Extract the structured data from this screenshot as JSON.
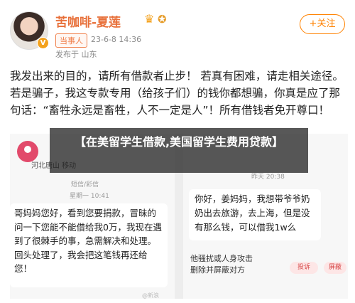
{
  "post": {
    "username": "苦咖啡-夏莲",
    "badge_icons": [
      "crown-icon",
      "fish-icon"
    ],
    "verified_icon": "v-badge-icon",
    "tag": "当事人",
    "time": "23-6-8 14:36",
    "location": "发布于 山东",
    "follow_label": "+关注",
    "text": "我发出来的目的，请所有借款者止步！ 若真有困难，请走相关途径。 若是骗子，我这专款专用（给孩子们）的钱你都想骗，你真是应了那句话：“畜牲永远是畜牲，人不一定是人”！所有借钱者免开尊口！"
  },
  "screenshot_left": {
    "contact_location": "河北唐山 移动",
    "sms_label": "短信/彩信",
    "sms_date": "星期一 10:41",
    "message": "哥妈妈您好，看到您要捐款，冒昧的问一下您能不能借给我0万，我现在遇到了很棘手的事，急需解决和处理。回头处理了，我会把这笔钱再还给您！",
    "watermark": "@新浪"
  },
  "screenshot_right": {
    "date": "昨天 20:38",
    "message": "你好，姜妈妈，我想带爷爷奶奶出去旅游，去上海，但是没有那么钱，可以借我1w么",
    "spam_text": "他骚扰或人身攻击\n删除并屏蔽对方",
    "report_label": "投诉",
    "block_label": "屏蔽"
  },
  "banner": {
    "title": "【在美留学生借款,美国留学生费用贷款】"
  },
  "colors": {
    "username": "#e8703a",
    "follow": "#ff8200",
    "banner_bg": "#1e1e1e"
  }
}
